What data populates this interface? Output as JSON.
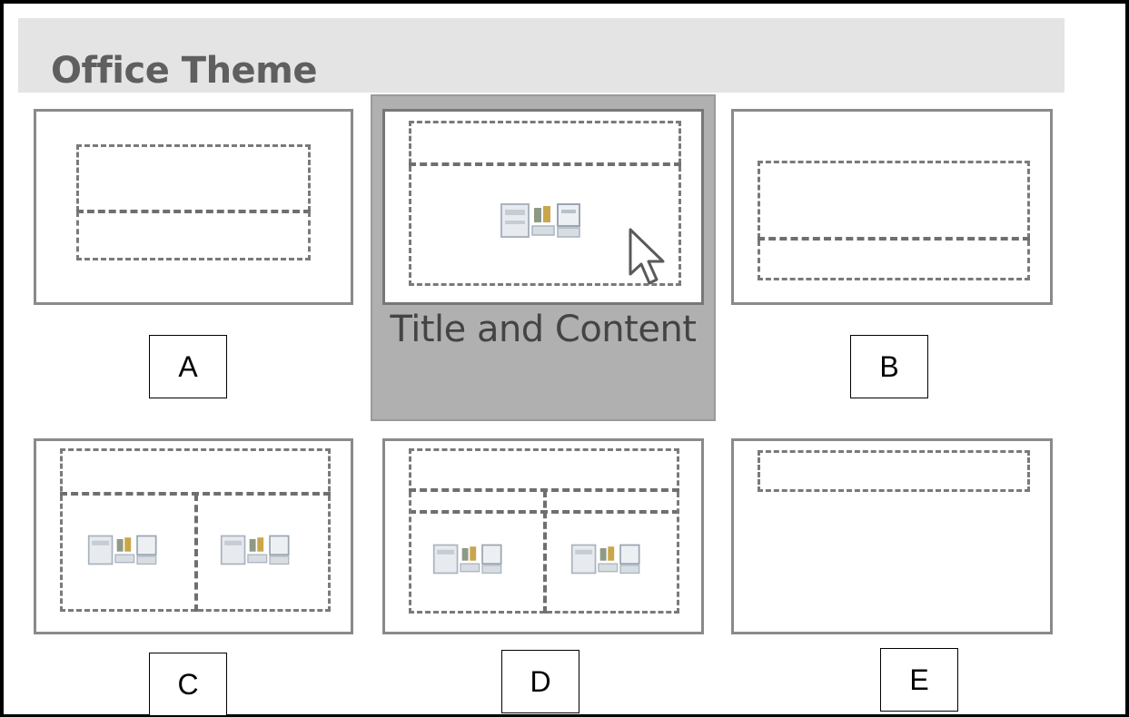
{
  "header": {
    "title": "Office Theme"
  },
  "layouts": [
    {
      "id": "title-slide",
      "marker": "A"
    },
    {
      "id": "title-and-content",
      "name": "Title and Content",
      "selected": true
    },
    {
      "id": "section-header",
      "marker": "B"
    },
    {
      "id": "two-content",
      "marker": "C"
    },
    {
      "id": "comparison",
      "marker": "D"
    },
    {
      "id": "title-only",
      "marker": "E"
    }
  ],
  "icons": {
    "content": "content-placeholder-icon",
    "cursor": "mouse-pointer-icon"
  },
  "colors": {
    "header_bg": "#e4e4e4",
    "selection_bg": "#b0b0b0",
    "tile_border": "#8a8a8a"
  }
}
